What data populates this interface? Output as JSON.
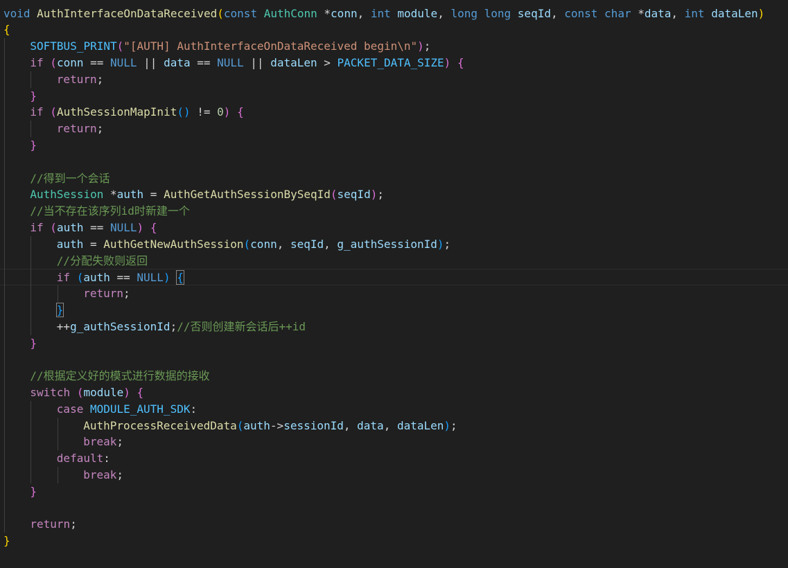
{
  "editor": {
    "language": "c",
    "theme_colors": {
      "background": "#1f1f1f",
      "keyword": "#569cd6",
      "control": "#c586c0",
      "function": "#dcdcaa",
      "variable": "#9cdcfe",
      "type": "#4ec9b0",
      "string": "#ce9178",
      "number": "#b5cea8",
      "constant": "#4fc1ff",
      "comment": "#6a9955",
      "punctuation": "#d4d4d4",
      "bracket_level1": "#ffd700",
      "bracket_level2": "#da70d6",
      "bracket_level3": "#179fff"
    },
    "current_line_index": 16,
    "lines": [
      {
        "indent": 0,
        "tokens": [
          [
            "void",
            "kw"
          ],
          [
            " ",
            "punc"
          ],
          [
            "AuthInterfaceOnDataReceived",
            "fn"
          ],
          [
            "(",
            "b1"
          ],
          [
            "const",
            "kw"
          ],
          [
            " ",
            "punc"
          ],
          [
            "AuthConn",
            "type"
          ],
          [
            " *",
            "punc"
          ],
          [
            "conn",
            "var"
          ],
          [
            ", ",
            "punc"
          ],
          [
            "int",
            "kw"
          ],
          [
            " ",
            "punc"
          ],
          [
            "module",
            "var"
          ],
          [
            ", ",
            "punc"
          ],
          [
            "long",
            "kw"
          ],
          [
            " ",
            "punc"
          ],
          [
            "long",
            "kw"
          ],
          [
            " ",
            "punc"
          ],
          [
            "seqId",
            "var"
          ],
          [
            ", ",
            "punc"
          ],
          [
            "const",
            "kw"
          ],
          [
            " ",
            "punc"
          ],
          [
            "char",
            "kw"
          ],
          [
            " *",
            "punc"
          ],
          [
            "data",
            "var"
          ],
          [
            ", ",
            "punc"
          ],
          [
            "int",
            "kw"
          ],
          [
            " ",
            "punc"
          ],
          [
            "dataLen",
            "var"
          ],
          [
            ")",
            "b1"
          ]
        ]
      },
      {
        "indent": 0,
        "tokens": [
          [
            "{",
            "b1"
          ]
        ]
      },
      {
        "indent": 1,
        "tokens": [
          [
            "SOFTBUS_PRINT",
            "const"
          ],
          [
            "(",
            "b2"
          ],
          [
            "\"[AUTH] AuthInterfaceOnDataReceived begin\\n\"",
            "str"
          ],
          [
            ")",
            "b2"
          ],
          [
            ";",
            "punc"
          ]
        ]
      },
      {
        "indent": 1,
        "tokens": [
          [
            "if",
            "ctrl"
          ],
          [
            " ",
            "punc"
          ],
          [
            "(",
            "b2"
          ],
          [
            "conn",
            "var"
          ],
          [
            " == ",
            "punc"
          ],
          [
            "NULL",
            "kw"
          ],
          [
            " || ",
            "punc"
          ],
          [
            "data",
            "var"
          ],
          [
            " == ",
            "punc"
          ],
          [
            "NULL",
            "kw"
          ],
          [
            " || ",
            "punc"
          ],
          [
            "dataLen",
            "var"
          ],
          [
            " > ",
            "punc"
          ],
          [
            "PACKET_DATA_SIZE",
            "const"
          ],
          [
            ")",
            "b2"
          ],
          [
            " ",
            "punc"
          ],
          [
            "{",
            "b2"
          ]
        ]
      },
      {
        "indent": 2,
        "tokens": [
          [
            "return",
            "ctrl"
          ],
          [
            ";",
            "punc"
          ]
        ]
      },
      {
        "indent": 1,
        "tokens": [
          [
            "}",
            "b2"
          ]
        ]
      },
      {
        "indent": 1,
        "tokens": [
          [
            "if",
            "ctrl"
          ],
          [
            " ",
            "punc"
          ],
          [
            "(",
            "b2"
          ],
          [
            "AuthSessionMapInit",
            "fn"
          ],
          [
            "(",
            "b3"
          ],
          [
            ")",
            "b3"
          ],
          [
            " != ",
            "punc"
          ],
          [
            "0",
            "num"
          ],
          [
            ")",
            "b2"
          ],
          [
            " ",
            "punc"
          ],
          [
            "{",
            "b2"
          ]
        ]
      },
      {
        "indent": 2,
        "tokens": [
          [
            "return",
            "ctrl"
          ],
          [
            ";",
            "punc"
          ]
        ]
      },
      {
        "indent": 1,
        "tokens": [
          [
            "}",
            "b2"
          ]
        ]
      },
      {
        "indent": 0,
        "tokens": []
      },
      {
        "indent": 1,
        "tokens": [
          [
            "//得到一个会话",
            "cmt"
          ]
        ]
      },
      {
        "indent": 1,
        "tokens": [
          [
            "AuthSession",
            "type"
          ],
          [
            " *",
            "punc"
          ],
          [
            "auth",
            "var"
          ],
          [
            " = ",
            "punc"
          ],
          [
            "AuthGetAuthSessionBySeqId",
            "fn"
          ],
          [
            "(",
            "b2"
          ],
          [
            "seqId",
            "var"
          ],
          [
            ")",
            "b2"
          ],
          [
            ";",
            "punc"
          ]
        ]
      },
      {
        "indent": 1,
        "tokens": [
          [
            "//当不存在该序列id时新建一个",
            "cmt"
          ]
        ]
      },
      {
        "indent": 1,
        "tokens": [
          [
            "if",
            "ctrl"
          ],
          [
            " ",
            "punc"
          ],
          [
            "(",
            "b2"
          ],
          [
            "auth",
            "var"
          ],
          [
            " == ",
            "punc"
          ],
          [
            "NULL",
            "kw"
          ],
          [
            ")",
            "b2"
          ],
          [
            " ",
            "punc"
          ],
          [
            "{",
            "b2"
          ]
        ]
      },
      {
        "indent": 2,
        "tokens": [
          [
            "auth",
            "var"
          ],
          [
            " = ",
            "punc"
          ],
          [
            "AuthGetNewAuthSession",
            "fn"
          ],
          [
            "(",
            "b3"
          ],
          [
            "conn",
            "var"
          ],
          [
            ", ",
            "punc"
          ],
          [
            "seqId",
            "var"
          ],
          [
            ", ",
            "punc"
          ],
          [
            "g_authSessionId",
            "var"
          ],
          [
            ")",
            "b3"
          ],
          [
            ";",
            "punc"
          ]
        ]
      },
      {
        "indent": 2,
        "tokens": [
          [
            "//分配失败则返回",
            "cmt"
          ]
        ]
      },
      {
        "indent": 2,
        "tokens": [
          [
            "if",
            "ctrl"
          ],
          [
            " ",
            "punc"
          ],
          [
            "(",
            "b3"
          ],
          [
            "auth",
            "var"
          ],
          [
            " == ",
            "punc"
          ],
          [
            "NULL",
            "kw"
          ],
          [
            ")",
            "b3"
          ],
          [
            " ",
            "punc"
          ],
          [
            "{",
            "b3box"
          ]
        ]
      },
      {
        "indent": 3,
        "tokens": [
          [
            "return",
            "ctrl"
          ],
          [
            ";",
            "punc"
          ]
        ]
      },
      {
        "indent": 2,
        "tokens": [
          [
            "}",
            "b3box"
          ]
        ]
      },
      {
        "indent": 2,
        "tokens": [
          [
            "++",
            "punc"
          ],
          [
            "g_authSessionId",
            "var"
          ],
          [
            ";",
            "punc"
          ],
          [
            "//否则创建新会话后++id",
            "cmt"
          ]
        ]
      },
      {
        "indent": 1,
        "tokens": [
          [
            "}",
            "b2"
          ]
        ]
      },
      {
        "indent": 0,
        "tokens": []
      },
      {
        "indent": 1,
        "tokens": [
          [
            "//根据定义好的模式进行数据的接收",
            "cmt"
          ]
        ]
      },
      {
        "indent": 1,
        "tokens": [
          [
            "switch",
            "ctrl"
          ],
          [
            " ",
            "punc"
          ],
          [
            "(",
            "b2"
          ],
          [
            "module",
            "var"
          ],
          [
            ")",
            "b2"
          ],
          [
            " ",
            "punc"
          ],
          [
            "{",
            "b2"
          ]
        ]
      },
      {
        "indent": 2,
        "tokens": [
          [
            "case",
            "ctrl"
          ],
          [
            " ",
            "punc"
          ],
          [
            "MODULE_AUTH_SDK",
            "const"
          ],
          [
            ":",
            "punc"
          ]
        ]
      },
      {
        "indent": 3,
        "tokens": [
          [
            "AuthProcessReceivedData",
            "fn"
          ],
          [
            "(",
            "b3"
          ],
          [
            "auth",
            "var"
          ],
          [
            "->",
            "punc"
          ],
          [
            "sessionId",
            "var"
          ],
          [
            ", ",
            "punc"
          ],
          [
            "data",
            "var"
          ],
          [
            ", ",
            "punc"
          ],
          [
            "dataLen",
            "var"
          ],
          [
            ")",
            "b3"
          ],
          [
            ";",
            "punc"
          ]
        ]
      },
      {
        "indent": 3,
        "tokens": [
          [
            "break",
            "ctrl"
          ],
          [
            ";",
            "punc"
          ]
        ]
      },
      {
        "indent": 2,
        "tokens": [
          [
            "default",
            "ctrl"
          ],
          [
            ":",
            "punc"
          ]
        ]
      },
      {
        "indent": 3,
        "tokens": [
          [
            "break",
            "ctrl"
          ],
          [
            ";",
            "punc"
          ]
        ]
      },
      {
        "indent": 1,
        "tokens": [
          [
            "}",
            "b2"
          ]
        ]
      },
      {
        "indent": 0,
        "tokens": []
      },
      {
        "indent": 1,
        "tokens": [
          [
            "return",
            "ctrl"
          ],
          [
            ";",
            "punc"
          ]
        ]
      },
      {
        "indent": 0,
        "tokens": [
          [
            "}",
            "b1"
          ]
        ]
      }
    ]
  }
}
